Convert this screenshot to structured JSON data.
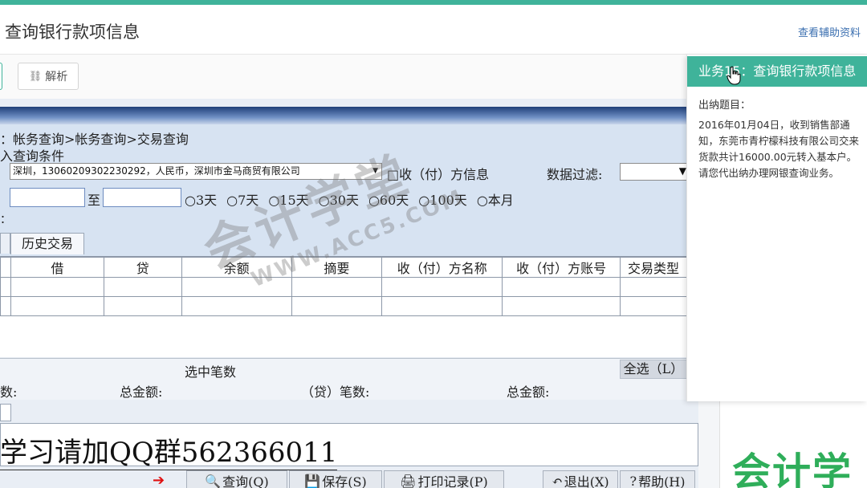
{
  "header": {
    "title": "查询银行款项信息",
    "aux_link": "查看辅助资料"
  },
  "toolbar": {
    "analyze_label": "解析"
  },
  "app": {
    "breadcrumb": "：帐务查询>帐务查询>交易查询",
    "condition_label": "入查询条件",
    "account_value": "深圳，13060209302230292，人民币，深圳市金马商贸有限公司",
    "party_info_label": "□收（付）方信息",
    "filter_label": "数据过滤:",
    "to_label": "至",
    "date_ranges": [
      "○3天",
      "○7天",
      "○15天",
      "○30天",
      "○60天",
      "○100天",
      "○本月"
    ],
    "stray_label": "：",
    "tab_history": "历史交易",
    "columns": [
      "借",
      "贷",
      "余额",
      "摘要",
      "收（付）方名称",
      "收（付）方账号",
      "交易类型"
    ],
    "selected_count_label": "选中笔数",
    "select_all_label": "全选（L）",
    "count_label_a": "数:",
    "total_amount_label_a": "总金额:",
    "count_label_b": "（贷）笔数:",
    "total_amount_label_b": "总金额:",
    "promo_text": "学习请加QQ群562366011",
    "buttons": {
      "query": "查询(Q)",
      "save": "保存(S)",
      "print": "打印记录(P)",
      "exit": "退出(X)",
      "help": "帮助(H)"
    }
  },
  "task": {
    "title": "业务15：查询银行款项信息",
    "question_label": "出纳题目：",
    "question_text": "2016年01月04日，收到销售部通知，东莞市青柠檬科技有限公司交来货款共计16000.00元转入基本户。请您代出纳办理网银查询业务。"
  },
  "watermark": {
    "main": "会计学堂",
    "sub": "WWW.ACC5.COM"
  },
  "brand": {
    "logo_text": "会计学"
  },
  "colors": {
    "accent": "#3fb39a",
    "band": "#1f3f78"
  }
}
